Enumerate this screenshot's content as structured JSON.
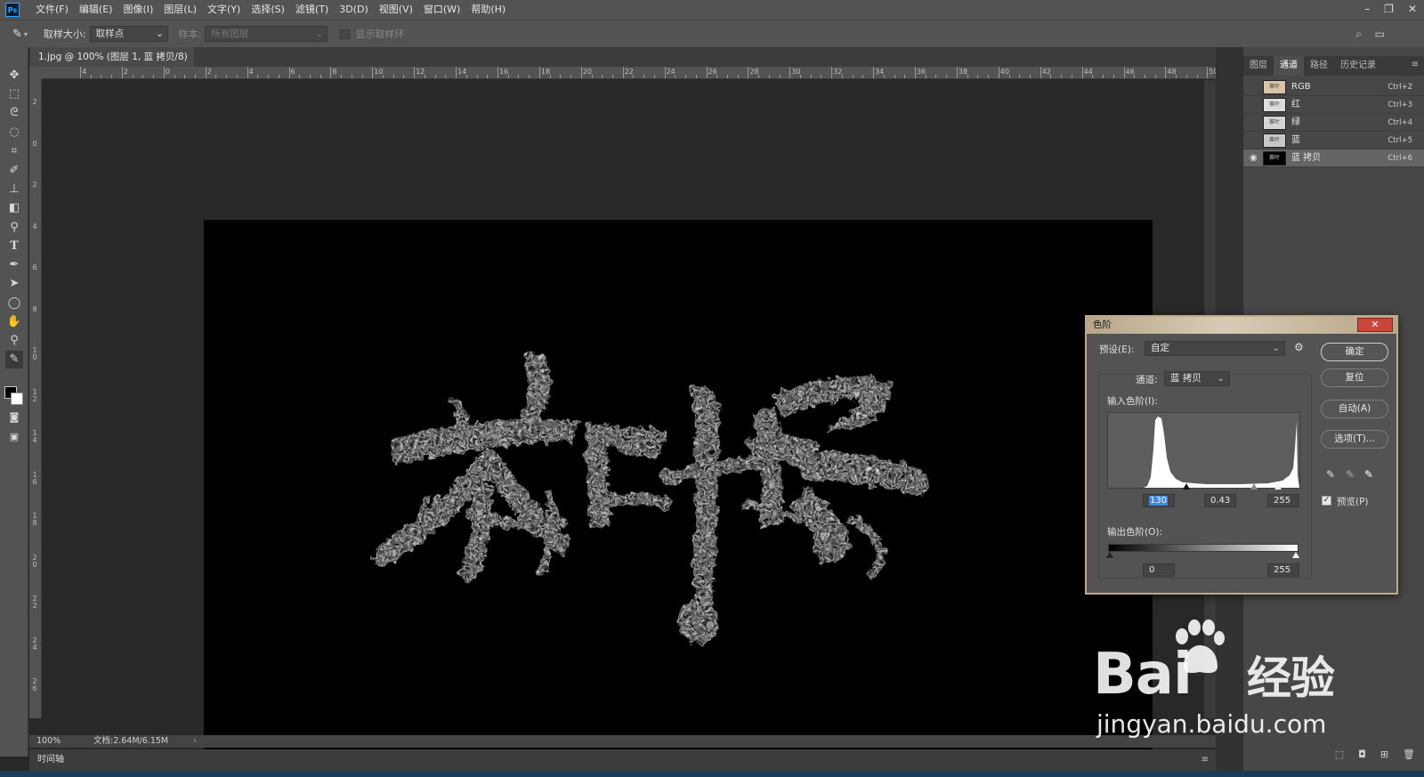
{
  "app": {
    "logo": "Ps",
    "menu": [
      "文件(F)",
      "编辑(E)",
      "图像(I)",
      "图层(L)",
      "文字(Y)",
      "选择(S)",
      "滤镜(T)",
      "3D(D)",
      "视图(V)",
      "窗口(W)",
      "帮助(H)"
    ],
    "window_controls": [
      "–",
      "❐",
      "✕"
    ]
  },
  "options": {
    "sample_size_label": "取样大小:",
    "sample_size_value": "取样点",
    "sample_label": "样本:",
    "sample_value": "所有图层",
    "show_ring_label": "显示取样环"
  },
  "document": {
    "tab_title": "1.jpg @ 100% (图层 1, 蓝 拷贝/8) *",
    "close": "×",
    "zoom": "100%",
    "doc_size": "文档:2.64M/6.15M",
    "timeline_label": "时间轴",
    "ruler_h": [
      "4",
      "2",
      "0",
      "2",
      "4",
      "6",
      "8",
      "10",
      "12",
      "14",
      "16",
      "18",
      "20",
      "22",
      "24",
      "26",
      "28",
      "30",
      "32",
      "34",
      "36",
      "38",
      "40",
      "42",
      "44",
      "46",
      "48",
      "50"
    ],
    "ruler_v": [
      "2",
      "0",
      "2",
      "4",
      "6",
      "8",
      "10",
      "12",
      "14",
      "16",
      "18",
      "20",
      "22",
      "24",
      "26"
    ]
  },
  "panels": {
    "tabs": [
      "图层",
      "通道",
      "路径",
      "历史记录"
    ],
    "active_tab": "通道",
    "channels": [
      {
        "name": "RGB",
        "shortcut": "Ctrl+2",
        "visible": false
      },
      {
        "name": "红",
        "shortcut": "Ctrl+3",
        "visible": false
      },
      {
        "name": "绿",
        "shortcut": "Ctrl+4",
        "visible": false
      },
      {
        "name": "蓝",
        "shortcut": "Ctrl+5",
        "visible": false
      },
      {
        "name": "蓝 拷贝",
        "shortcut": "Ctrl+6",
        "visible": true
      }
    ]
  },
  "levels": {
    "title": "色阶",
    "preset_label": "预设(E):",
    "preset_value": "自定",
    "channel_label": "通道:",
    "channel_value": "蓝 拷贝",
    "input_label": "输入色阶(I):",
    "input_black": "130",
    "input_gamma": "0.43",
    "input_white": "255",
    "output_label": "输出色阶(O):",
    "output_black": "0",
    "output_white": "255",
    "buttons": {
      "ok": "确定",
      "reset": "复位",
      "auto": "自动(A)",
      "options": "选项(T)..."
    },
    "preview_label": "预览(P)",
    "preview_checked": true
  },
  "watermark": {
    "brand": "Bai",
    "brand_tail": "经验",
    "url": "jingyan.baidu.com"
  }
}
